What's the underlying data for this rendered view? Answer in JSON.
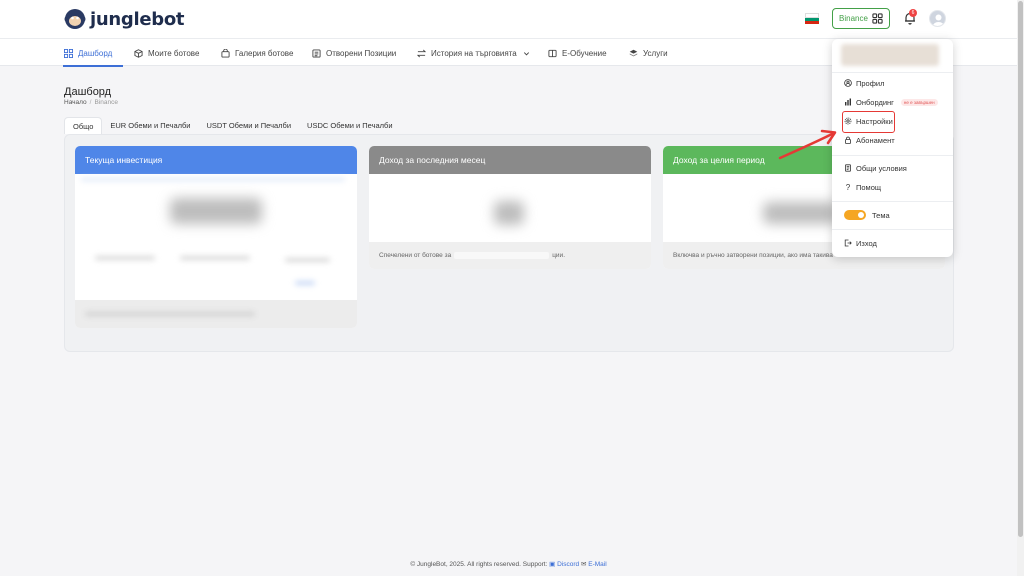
{
  "brand": {
    "name": "junglebot"
  },
  "header": {
    "exchange_label": "Binance",
    "notifications_count": "6",
    "flag_colors": [
      "#ffffff",
      "#00966e",
      "#d62612"
    ]
  },
  "nav": {
    "items": [
      {
        "label": "Дашборд",
        "icon": "grid-icon",
        "active": true
      },
      {
        "label": "Моите ботове",
        "icon": "cube-icon"
      },
      {
        "label": "Галерия ботове",
        "icon": "bag-icon"
      },
      {
        "label": "Отворени Позиции",
        "icon": "list-icon"
      },
      {
        "label": "История на търговията",
        "icon": "swap-icon"
      },
      {
        "label": "Е-Обучение",
        "icon": "book-icon"
      },
      {
        "label": "Услуги",
        "icon": "layers-icon"
      }
    ]
  },
  "page": {
    "title": "Дашборд",
    "breadcrumb": {
      "home": "Начало",
      "current": "Binance"
    }
  },
  "tabs": [
    {
      "label": "Общо",
      "active": true
    },
    {
      "label": "EUR Обеми и Печалби"
    },
    {
      "label": "USDT Обеми и Печалби"
    },
    {
      "label": "USDC Обеми и Печалби"
    }
  ],
  "cards": [
    {
      "title": "Текуща инвестиция",
      "color": "#4f86e8",
      "footer": ""
    },
    {
      "title": "Доход за последния месец",
      "color": "#8a8a8a",
      "footer": "Спечелени от ботове за",
      "footer_tail": "ции."
    },
    {
      "title": "Доход за целия период",
      "color": "#5cb85c",
      "footer": "Включва и ръчно затворени позиции, ако има такива"
    }
  ],
  "menu": {
    "items": [
      {
        "label": "Профил",
        "icon": "user-circle-icon"
      },
      {
        "label": "Онбординг",
        "icon": "chart-bar-icon",
        "badge": "не е завършен"
      },
      {
        "label": "Настройки",
        "icon": "gear-icon"
      },
      {
        "label": "Абонамент",
        "icon": "lock-icon"
      },
      {
        "label": "Общи условия",
        "icon": "document-icon"
      },
      {
        "label": "Помощ",
        "icon": "question-icon"
      },
      {
        "label": "Тема",
        "icon": "theme-toggle"
      },
      {
        "label": "Изход",
        "icon": "logout-icon"
      }
    ]
  },
  "footer": {
    "text": "© JungleBot, 2025. All rights reserved. Support:",
    "discord": "Discord",
    "email": "E-Mail"
  },
  "colors": {
    "accent": "#3d6fd6",
    "highlight": "#e53935"
  }
}
